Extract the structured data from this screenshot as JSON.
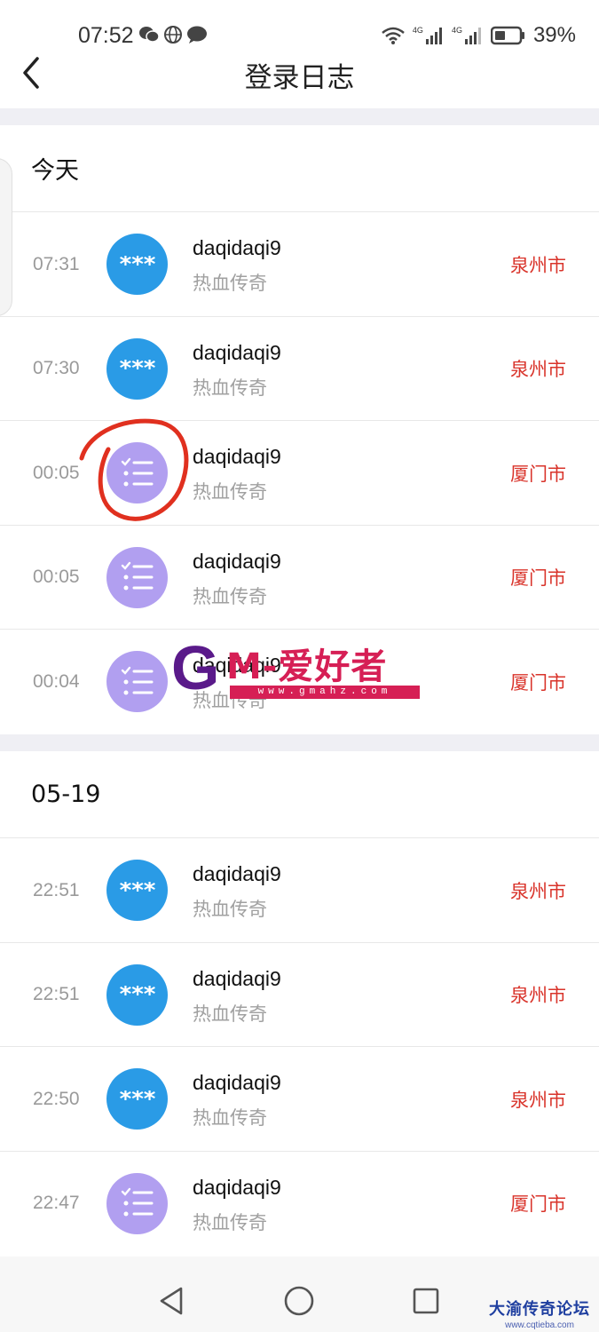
{
  "status_bar": {
    "time": "07:52",
    "battery": "39%",
    "network_1": "4G",
    "network_2": "4G"
  },
  "header": {
    "title": "登录日志"
  },
  "sections": [
    {
      "label": "今天",
      "entries": [
        {
          "time": "07:31",
          "user": "daqidaqi9",
          "game": "热血传奇",
          "city": "泉州市",
          "icon": "password-icon"
        },
        {
          "time": "07:30",
          "user": "daqidaqi9",
          "game": "热血传奇",
          "city": "泉州市",
          "icon": "password-icon"
        },
        {
          "time": "00:05",
          "user": "daqidaqi9",
          "game": "热血传奇",
          "city": "厦门市",
          "icon": "checklist-icon"
        },
        {
          "time": "00:05",
          "user": "daqidaqi9",
          "game": "热血传奇",
          "city": "厦门市",
          "icon": "checklist-icon"
        },
        {
          "time": "00:04",
          "user": "daqidaqi9",
          "game": "热血传奇",
          "city": "厦门市",
          "icon": "checklist-icon"
        }
      ]
    },
    {
      "label": "05-19",
      "entries": [
        {
          "time": "22:51",
          "user": "daqidaqi9",
          "game": "热血传奇",
          "city": "泉州市",
          "icon": "password-icon"
        },
        {
          "time": "22:51",
          "user": "daqidaqi9",
          "game": "热血传奇",
          "city": "泉州市",
          "icon": "password-icon"
        },
        {
          "time": "22:50",
          "user": "daqidaqi9",
          "game": "热血传奇",
          "city": "泉州市",
          "icon": "password-icon"
        },
        {
          "time": "22:47",
          "user": "daqidaqi9",
          "game": "热血传奇",
          "city": "厦门市",
          "icon": "checklist-icon"
        }
      ]
    }
  ],
  "watermark": {
    "letter": "G",
    "text": "M-爱好者",
    "url": "www.gmahz.com"
  },
  "forum_watermark": {
    "name": "大渝传奇论坛",
    "url": "www.cqtieba.com"
  },
  "colors": {
    "accent_red": "#d9342b",
    "avatar_blue": "#2a9be6",
    "avatar_purple": "#b19ff0"
  }
}
